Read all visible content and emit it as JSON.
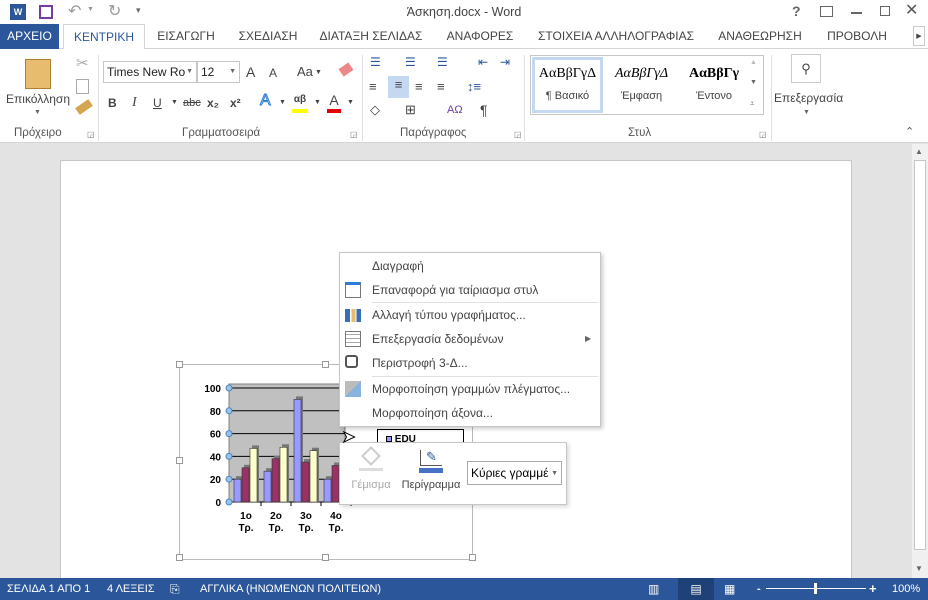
{
  "window": {
    "title": "Άσκηση.docx - Word",
    "help": "?",
    "controls": [
      "ribbon-display",
      "minimize",
      "restore",
      "close"
    ]
  },
  "tabs": [
    {
      "label": "ΑΡΧΕΙΟ"
    },
    {
      "label": "ΚΕΝΤΡΙΚΗ",
      "active": true
    },
    {
      "label": "ΕΙΣΑΓΩΓΗ"
    },
    {
      "label": "ΣΧΕΔΙΑΣΗ"
    },
    {
      "label": "ΔΙΑΤΑΞΗ ΣΕΛΙΔΑΣ"
    },
    {
      "label": "ΑΝΑΦΟΡΕΣ"
    },
    {
      "label": "ΣΤΟΙΧΕΙΑ ΑΛΛΗΛΟΓΡΑΦΙΑΣ"
    },
    {
      "label": "ΑΝΑΘΕΩΡΗΣΗ"
    },
    {
      "label": "ΠΡΟΒΟΛΗ"
    }
  ],
  "ribbon": {
    "clipboard": {
      "label": "Πρόχειρο",
      "paste": "Επικόλληση"
    },
    "font": {
      "label": "Γραμματοσειρά",
      "font_name": "Times New Ro",
      "font_size": "12",
      "aa": "Aa",
      "bold": "B",
      "italic": "I",
      "underline": "U",
      "strike": "abc",
      "sub": "x₂",
      "sup": "x²",
      "grow": "A",
      "shrink": "A",
      "effects": "A",
      "highlight": "αβ",
      "color": "A",
      "highlight_color": "#ffff00",
      "font_color": "#e00000"
    },
    "paragraph": {
      "label": "Παράγραφος",
      "pilcrow": "¶"
    },
    "styles": {
      "label": "Στυλ",
      "items": [
        {
          "sample": "AαBβΓγΔ",
          "name": "¶ Βασικό"
        },
        {
          "sample": "AαBβΓγΔ",
          "name": "Έμφαση"
        },
        {
          "sample": "AαBβΓγ",
          "name": "Έντονο"
        }
      ]
    },
    "editing": {
      "label": "Επεξεργασία"
    }
  },
  "chart_data": {
    "type": "bar",
    "subtype": "3d-clustered-column",
    "categories": [
      "1ο Τρ.",
      "2ο Τρ.",
      "3ο Τρ.",
      "4ο Τρ."
    ],
    "y_ticks": [
      "100",
      "80",
      "60",
      "40",
      "20",
      "0"
    ],
    "ylim": [
      0,
      100
    ],
    "grid": true,
    "series": [
      {
        "name": "EDU",
        "values": [
          20,
          27,
          90,
          20
        ],
        "color": "#9999ff"
      },
      {
        "values": [
          30,
          38,
          35,
          32
        ],
        "color": "#993366"
      },
      {
        "values": [
          47,
          48,
          45,
          45
        ],
        "color": "#ffffcc"
      }
    ],
    "legend_position": "right"
  },
  "context_menu": {
    "items": [
      {
        "label": "Διαγραφή",
        "icon": "none"
      },
      {
        "label": "Επαναφορά για ταίριασμα στυλ",
        "icon": "reset-style-icon"
      },
      {
        "label": "Αλλαγή τύπου γραφήματος...",
        "icon": "chart-type-icon"
      },
      {
        "label": "Επεξεργασία δεδομένων",
        "icon": "edit-data-icon",
        "submenu": true
      },
      {
        "label": "Περιστροφή 3-Δ...",
        "icon": "rotate-3d-icon"
      },
      {
        "label": "Μορφοποίηση γραμμών πλέγματος...",
        "icon": "format-gridlines-icon",
        "disabled_icon": true
      },
      {
        "label": "Μορφοποίηση άξονα...",
        "icon": "none"
      }
    ]
  },
  "mini_toolbar": {
    "fill": "Γέμισμα",
    "outline": "Περίγραμμα",
    "selector": "Κύριες γραμμέ"
  },
  "status": {
    "page": "ΣΕΛΙΔΑ 1 ΑΠΟ 1",
    "words": "4 ΛΕΞΕΙΣ",
    "language": "ΑΓΓΛΙΚΑ (ΗΝΩΜΕΝΩΝ ΠΟΛΙΤΕΙΩΝ)",
    "zoom": "100%",
    "zoom_minus": "-",
    "zoom_plus": "+",
    "zoom_level": 100
  }
}
